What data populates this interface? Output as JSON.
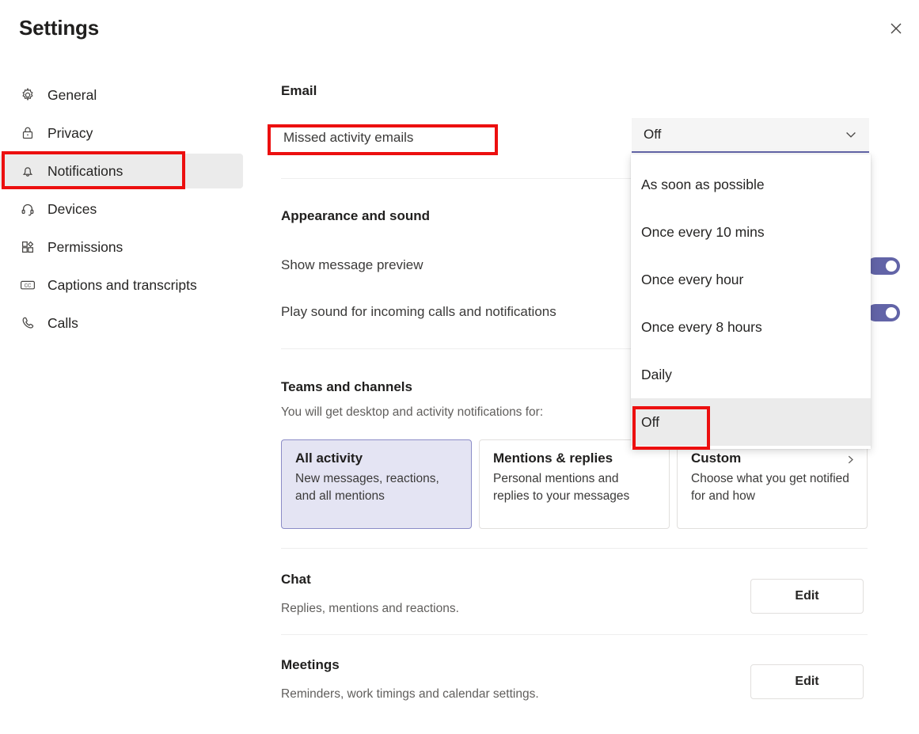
{
  "header": {
    "title": "Settings",
    "close_icon": "close-icon"
  },
  "sidebar": {
    "items": [
      {
        "label": "General",
        "icon": "gear-icon",
        "selected": false
      },
      {
        "label": "Privacy",
        "icon": "lock-icon",
        "selected": false
      },
      {
        "label": "Notifications",
        "icon": "bell-icon",
        "selected": true
      },
      {
        "label": "Devices",
        "icon": "headset-icon",
        "selected": false
      },
      {
        "label": "Permissions",
        "icon": "permissions-icon",
        "selected": false
      },
      {
        "label": "Captions and transcripts",
        "icon": "closed-caption-icon",
        "selected": false
      },
      {
        "label": "Calls",
        "icon": "phone-icon",
        "selected": false
      }
    ]
  },
  "email": {
    "heading": "Email",
    "row_label": "Missed activity emails",
    "combo": {
      "value": "Off",
      "chevron_icon": "chevron-down-icon",
      "options": [
        {
          "label": "As soon as possible",
          "hovered": false
        },
        {
          "label": "Once every 10 mins",
          "hovered": false
        },
        {
          "label": "Once every hour",
          "hovered": false
        },
        {
          "label": "Once every 8 hours",
          "hovered": false
        },
        {
          "label": "Daily",
          "hovered": false
        },
        {
          "label": "Off",
          "hovered": true
        }
      ]
    }
  },
  "appearance": {
    "heading": "Appearance and sound",
    "rows": [
      {
        "label": "Show message preview",
        "toggle": "on"
      },
      {
        "label": "Play sound for incoming calls and notifications",
        "toggle": "on"
      }
    ]
  },
  "teams_channels": {
    "heading": "Teams and channels",
    "subtitle": "You will get desktop and activity notifications for:",
    "cards": [
      {
        "title": "All activity",
        "desc": "New messages, reactions, and all mentions",
        "selected": true,
        "chevron": false
      },
      {
        "title": "Mentions & replies",
        "desc": "Personal mentions and replies to your messages",
        "selected": false,
        "chevron": false
      },
      {
        "title": "Custom",
        "desc": "Choose what you get notified for and how",
        "selected": false,
        "chevron": true
      }
    ]
  },
  "chat": {
    "title": "Chat",
    "desc": "Replies, mentions and reactions.",
    "edit_label": "Edit"
  },
  "meetings": {
    "title": "Meetings",
    "desc": "Reminders, work timings and calendar settings.",
    "edit_label": "Edit"
  },
  "colors": {
    "accent": "#6264a7",
    "selected_card_bg": "#e4e4f3",
    "annotation": "#ec0f0f",
    "hover_bg": "#ebebeb"
  }
}
